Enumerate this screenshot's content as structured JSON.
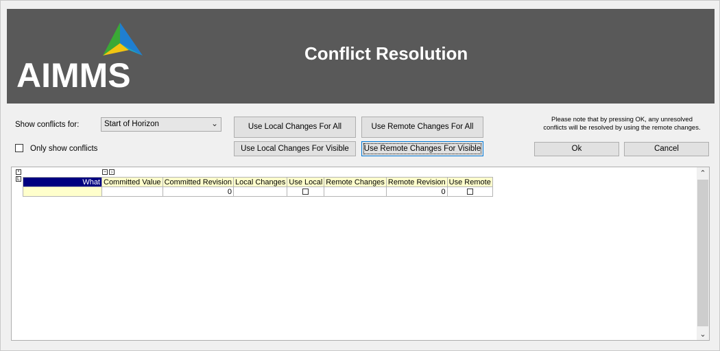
{
  "header": {
    "logo": "AIMMS",
    "title": "Conflict Resolution"
  },
  "controls": {
    "show_conflicts_label": "Show conflicts for:",
    "show_conflicts_value": "Start of Horizon",
    "only_show_conflicts_label": "Only show conflicts",
    "use_local_all": "Use Local Changes For All",
    "use_remote_all": "Use Remote Changes For All",
    "use_local_visible": "Use Local Changes For Visible",
    "use_remote_visible": "Use Remote Changes For Visible",
    "note_line1": "Please note that by pressing OK, any unresolved",
    "note_line2": "conflicts will be resolved by using the remote changes.",
    "ok": "Ok",
    "cancel": "Cancel"
  },
  "table": {
    "columns": [
      "What",
      "Committed Value",
      "Committed Revision",
      "Local Changes",
      "Use Local",
      "Remote Changes",
      "Remote Revision",
      "Use Remote"
    ],
    "row": {
      "what": "",
      "committed_value": "",
      "committed_revision": "0",
      "local_changes": "",
      "remote_changes": "",
      "remote_revision": "0"
    }
  },
  "colors": {
    "header_bg": "#595959",
    "what_header_bg": "#000080",
    "column_header_bg": "#ffffcc"
  }
}
